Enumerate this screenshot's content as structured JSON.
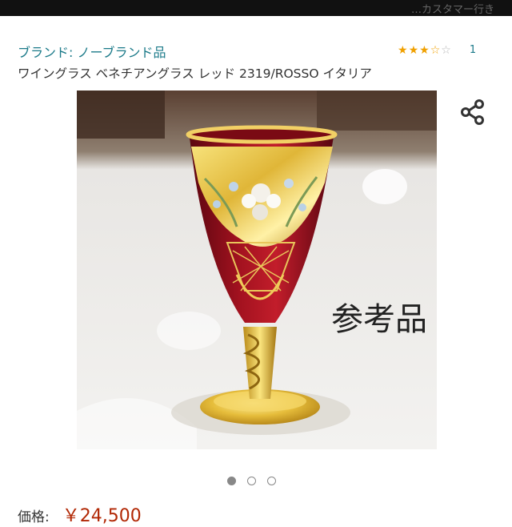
{
  "status_bar": {
    "text": "…カスタマー行き"
  },
  "product": {
    "brand": "ブランド: ノーブランド品",
    "title": "ワイングラス ベネチアングラス レッド 2319/ROSSO イタリア",
    "rating": {
      "stars": 3.5,
      "max": 5,
      "count": "1"
    },
    "image": {
      "description_icon": "wine-glass-photo",
      "overlay_text": "参考品"
    },
    "carousel": {
      "total": 3,
      "active_index": 0
    },
    "price": {
      "label": "価格:",
      "value": "￥24,500"
    }
  },
  "icons": {
    "share": "share-icon"
  },
  "colors": {
    "accent": "#1b7a89",
    "star": "#f0a000",
    "price": "#b12704",
    "topbar": "#111111"
  }
}
